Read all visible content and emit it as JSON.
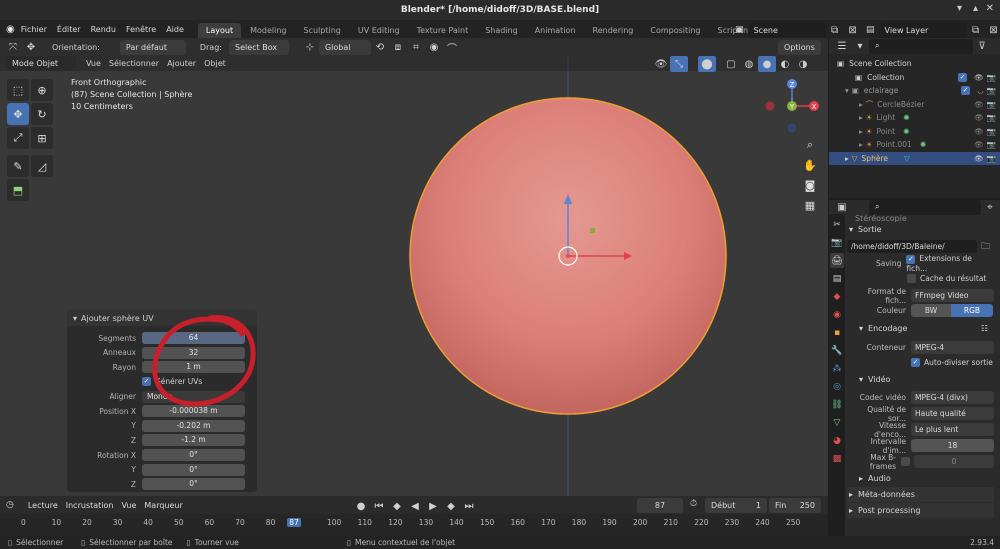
{
  "window": {
    "title": "Blender* [/home/didoff/3D/BASE.blend]"
  },
  "menubar": {
    "menus": [
      "Fichier",
      "Éditer",
      "Rendu",
      "Fenêtre",
      "Aide"
    ],
    "workspaces": [
      "Layout",
      "Modeling",
      "Sculpting",
      "UV Editing",
      "Texture Paint",
      "Shading",
      "Animation",
      "Rendering",
      "Compositing",
      "Scripting"
    ],
    "active_workspace": "Layout",
    "scene": "Scene",
    "view_layer": "View Layer"
  },
  "viewport_header": {
    "orientation_label": "Orientation:",
    "orientation_value": "Par défaut",
    "drag_label": "Drag:",
    "drag_value": "Select Box",
    "transform_orientation": "Global",
    "options": "Options",
    "mode": "Mode Objet",
    "menus": [
      "Vue",
      "Sélectionner",
      "Ajouter",
      "Objet"
    ]
  },
  "viewport": {
    "view_name": "Front Orthographic",
    "collection_info": "(87) Scene Collection | Sphère",
    "scale": "10 Centimeters",
    "gizmo_axes": {
      "z": "Z",
      "y": "Y",
      "x": "X"
    }
  },
  "redo_panel": {
    "title": "Ajouter sphère UV",
    "segments_label": "Segments",
    "segments": "64",
    "rings_label": "Anneaux",
    "rings": "32",
    "radius_label": "Rayon",
    "radius": "1 m",
    "gen_uv": "Générer UVs",
    "align_label": "Aligner",
    "align": "Monde",
    "location_label": "Position X",
    "loc_x": "-0.000038 m",
    "y_label": "Y",
    "loc_y": "-0.202 m",
    "z_label": "Z",
    "loc_z": "-1.2 m",
    "rotation_label": "Rotation X",
    "rot_x": "0°",
    "rot_y": "0°",
    "rot_z": "0°"
  },
  "timeline": {
    "playback": "Lecture",
    "keying": "Incrustation",
    "view": "Vue",
    "markers": "Marqueur",
    "current_frame": "87",
    "start_label": "Début",
    "start": "1",
    "end_label": "Fin",
    "end": "250",
    "ticks": [
      "0",
      "10",
      "20",
      "30",
      "40",
      "50",
      "60",
      "70",
      "80",
      "87",
      "100",
      "110",
      "120",
      "130",
      "140",
      "150",
      "160",
      "170",
      "180",
      "190",
      "200",
      "210",
      "220",
      "230",
      "240",
      "250"
    ]
  },
  "statusbar": {
    "select": "Sélectionner",
    "box_select": "Sélectionner par boîte",
    "rotate": "Tourner vue",
    "context_menu": "Menu contextuel de l'objet",
    "version": "2.93.4"
  },
  "outliner": {
    "items": [
      {
        "name": "Scene Collection"
      },
      {
        "name": "Collection"
      },
      {
        "name": "eclairage"
      },
      {
        "name": "CercleBézier"
      },
      {
        "name": "Light"
      },
      {
        "name": "Point"
      },
      {
        "name": "Point.001"
      },
      {
        "name": "Sphère"
      }
    ]
  },
  "properties": {
    "stereoscopy": "Stéréoscopie",
    "output_section": "Sortie",
    "output_path": "/home/didoff/3D/Baleine/",
    "saving_label": "Saving",
    "file_extensions": "Extensions de fich...",
    "cache_result": "Cache du résultat",
    "file_format_label": "Format de fich...",
    "file_format": "FFmpeg Video",
    "color_label": "Couleur",
    "color_bw": "BW",
    "color_rgb": "RGB",
    "encoding_section": "Encodage",
    "container_label": "Conteneur",
    "container": "MPEG-4",
    "autosplit": "Auto-diviser sortie",
    "video_section": "Vidéo",
    "codec_label": "Codec vidéo",
    "codec": "MPEG-4 (divx)",
    "quality_label": "Qualité de sor...",
    "quality": "Haute qualité",
    "speed_label": "Vitesse d'enco...",
    "speed": "Le plus lent",
    "keyframe_label": "Intervalle d'im...",
    "keyframe": "18",
    "bframes_label": "Max B-frames",
    "bframes": "0",
    "audio_section": "Audio",
    "metadata_section": "Méta-données",
    "postprocessing_section": "Post processing"
  },
  "colors": {
    "sphere": "#e0807a",
    "sphere_outline": "#f0a030",
    "accent": "#4772b3"
  }
}
